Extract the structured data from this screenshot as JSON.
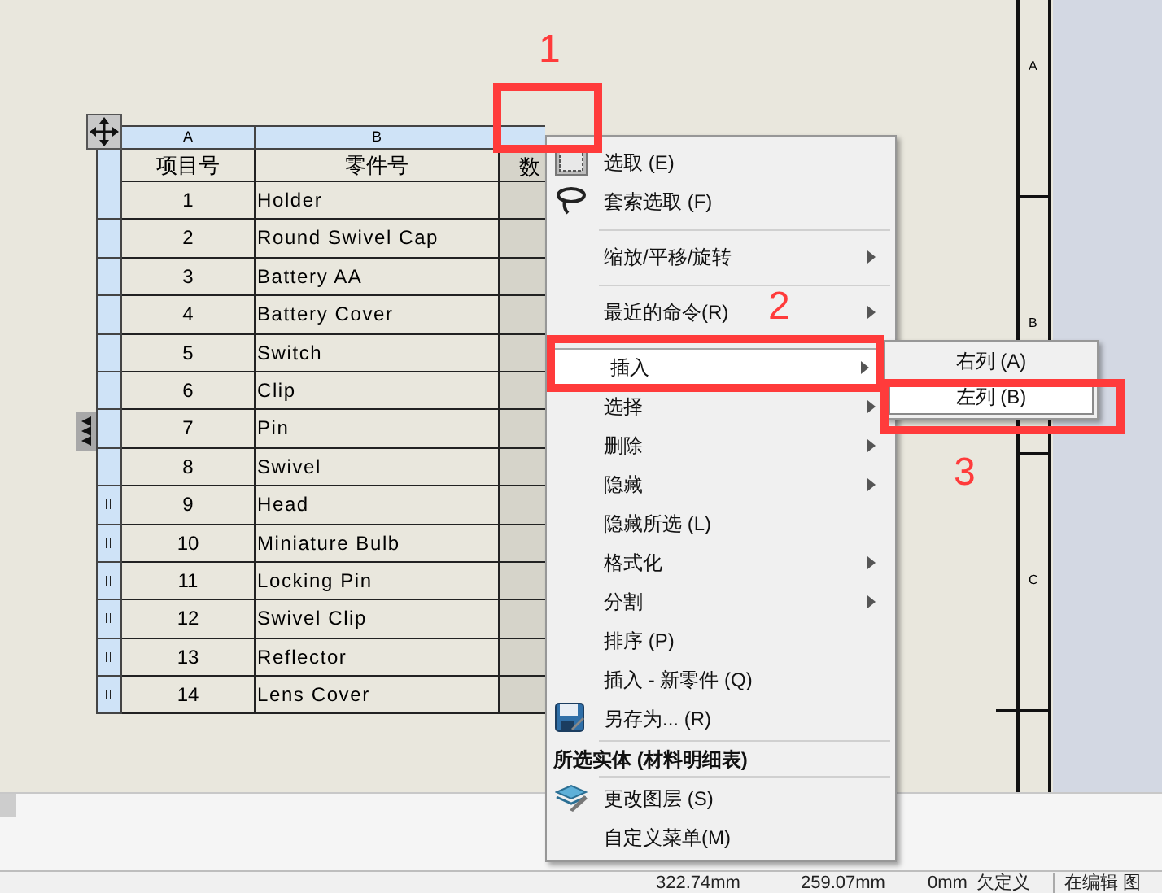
{
  "table": {
    "column_letters": [
      "A",
      "B"
    ],
    "headers": [
      "项目号",
      "零件号",
      "数"
    ],
    "rows": [
      {
        "item": "1",
        "part": "Holder",
        "marked": false
      },
      {
        "item": "2",
        "part": "Round Swivel Cap",
        "marked": false
      },
      {
        "item": "3",
        "part": "Battery AA",
        "marked": false
      },
      {
        "item": "4",
        "part": "Battery Cover",
        "marked": false
      },
      {
        "item": "5",
        "part": "Switch",
        "marked": false
      },
      {
        "item": "6",
        "part": "Clip",
        "marked": false
      },
      {
        "item": "7",
        "part": "Pin",
        "marked": false
      },
      {
        "item": "8",
        "part": "Swivel",
        "marked": false
      },
      {
        "item": "9",
        "part": "Head",
        "marked": true
      },
      {
        "item": "10",
        "part": "Miniature Bulb",
        "marked": true
      },
      {
        "item": "11",
        "part": "Locking Pin",
        "marked": true
      },
      {
        "item": "12",
        "part": "Swivel Clip",
        "marked": true
      },
      {
        "item": "13",
        "part": "Reflector",
        "marked": true
      },
      {
        "item": "14",
        "part": "Lens Cover",
        "marked": true
      }
    ]
  },
  "context_menu": {
    "items": [
      {
        "kind": "item",
        "label": "选取 (E)",
        "submenu": false,
        "selected": false
      },
      {
        "kind": "item",
        "label": "套索选取 (F)",
        "submenu": false,
        "selected": false
      },
      {
        "kind": "separator"
      },
      {
        "kind": "item",
        "label": "缩放/平移/旋转",
        "submenu": true,
        "selected": false
      },
      {
        "kind": "separator"
      },
      {
        "kind": "item",
        "label": "最近的命令(R)",
        "submenu": true,
        "selected": false
      },
      {
        "kind": "separator"
      },
      {
        "kind": "item",
        "label": "插入",
        "submenu": true,
        "selected": true
      },
      {
        "kind": "item",
        "label": "选择",
        "submenu": true,
        "selected": false
      },
      {
        "kind": "item",
        "label": "删除",
        "submenu": true,
        "selected": false
      },
      {
        "kind": "item",
        "label": "隐藏",
        "submenu": true,
        "selected": false
      },
      {
        "kind": "item",
        "label": "隐藏所选 (L)",
        "submenu": false,
        "selected": false
      },
      {
        "kind": "item",
        "label": "格式化",
        "submenu": true,
        "selected": false
      },
      {
        "kind": "item",
        "label": "分割",
        "submenu": true,
        "selected": false
      },
      {
        "kind": "item",
        "label": "排序 (P)",
        "submenu": false,
        "selected": false
      },
      {
        "kind": "item",
        "label": "插入 - 新零件 (Q)",
        "submenu": false,
        "selected": false
      },
      {
        "kind": "item",
        "label": "另存为... (R)",
        "submenu": false,
        "selected": false
      },
      {
        "kind": "separator"
      },
      {
        "kind": "section",
        "label": "所选实体 (材料明细表)"
      },
      {
        "kind": "separator"
      },
      {
        "kind": "item",
        "label": "更改图层 (S)",
        "submenu": false,
        "selected": false
      },
      {
        "kind": "item",
        "label": "自定义菜单(M)",
        "submenu": false,
        "selected": false
      }
    ],
    "submenu": [
      {
        "label": "右列 (A)",
        "selected": false
      },
      {
        "label": "左列 (B)",
        "selected": true
      }
    ]
  },
  "sheet_zones": [
    "A",
    "B",
    "C"
  ],
  "annotations": [
    {
      "label": "1"
    },
    {
      "label": "2"
    },
    {
      "label": "3"
    }
  ],
  "status_bar": [
    "322.74mm",
    "259.07mm",
    "0mm",
    "欠定义",
    "在编辑 图"
  ]
}
